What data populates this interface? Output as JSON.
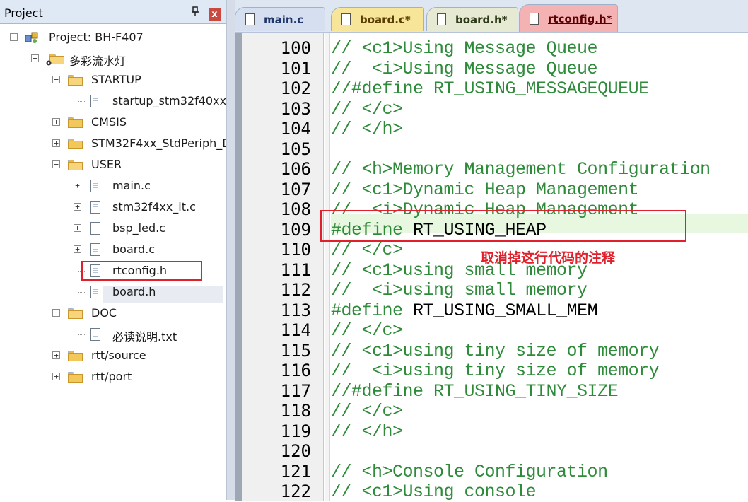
{
  "panel": {
    "title": "Project",
    "pin_icon": "pin-icon",
    "close_icon": "close-icon",
    "close_glyph": "x"
  },
  "tree": {
    "project": "Project: BH-F407",
    "target": "多彩流水灯",
    "groups": [
      {
        "name": "STARTUP",
        "files": [
          "startup_stm32f40xx."
        ]
      },
      {
        "name": "CMSIS"
      },
      {
        "name": "STM32F4xx_StdPeriph_D"
      },
      {
        "name": "USER",
        "files": [
          "main.c",
          "stm32f4xx_it.c",
          "bsp_led.c",
          "board.c",
          "rtconfig.h",
          "board.h"
        ]
      },
      {
        "name": "DOC",
        "files": [
          "必读说明.txt"
        ]
      },
      {
        "name": "rtt/source"
      },
      {
        "name": "rtt/port"
      }
    ]
  },
  "tabs": [
    {
      "label": "main.c"
    },
    {
      "label": "board.c*"
    },
    {
      "label": "board.h*"
    },
    {
      "label": "rtconfig.h*",
      "active": true
    }
  ],
  "code": [
    {
      "no": "100",
      "text": "// <c1>Using Message Queue",
      "kind": "comment"
    },
    {
      "no": "101",
      "text": "//  <i>Using Message Queue",
      "kind": "comment"
    },
    {
      "no": "102",
      "text": "//#define RT_USING_MESSAGEQUEUE",
      "kind": "comment"
    },
    {
      "no": "103",
      "text": "// </c>",
      "kind": "comment"
    },
    {
      "no": "104",
      "text": "// </h>",
      "kind": "comment"
    },
    {
      "no": "105",
      "text": "",
      "kind": "comment"
    },
    {
      "no": "106",
      "text": "// <h>Memory Management Configuration",
      "kind": "comment"
    },
    {
      "no": "107",
      "text": "// <c1>Dynamic Heap Management",
      "kind": "comment"
    },
    {
      "no": "108",
      "text": "//  <i>Dynamic Heap Management",
      "kind": "comment"
    },
    {
      "no": "109",
      "directive": "#define",
      "text": " RT_USING_HEAP",
      "kind": "define"
    },
    {
      "no": "110",
      "text": "// </c>",
      "kind": "comment"
    },
    {
      "no": "111",
      "text": "// <c1>using small memory",
      "kind": "comment"
    },
    {
      "no": "112",
      "text": "//  <i>using small memory",
      "kind": "comment"
    },
    {
      "no": "113",
      "directive": "#define",
      "text": " RT_USING_SMALL_MEM",
      "kind": "define"
    },
    {
      "no": "114",
      "text": "// </c>",
      "kind": "comment"
    },
    {
      "no": "115",
      "text": "// <c1>using tiny size of memory",
      "kind": "comment"
    },
    {
      "no": "116",
      "text": "//  <i>using tiny size of memory",
      "kind": "comment"
    },
    {
      "no": "117",
      "text": "//#define RT_USING_TINY_SIZE",
      "kind": "comment"
    },
    {
      "no": "118",
      "text": "// </c>",
      "kind": "comment"
    },
    {
      "no": "119",
      "text": "// </h>",
      "kind": "comment"
    },
    {
      "no": "120",
      "text": "",
      "kind": "comment"
    },
    {
      "no": "121",
      "text": "// <h>Console Configuration",
      "kind": "comment"
    },
    {
      "no": "122",
      "text": "// <c1>Using console",
      "kind": "comment"
    }
  ],
  "annotation": "取消掉这行代码的注释",
  "colors": {
    "comment": "#2e8b3a",
    "highlight": "#e0202a",
    "current_line": "#e7f7e0"
  }
}
